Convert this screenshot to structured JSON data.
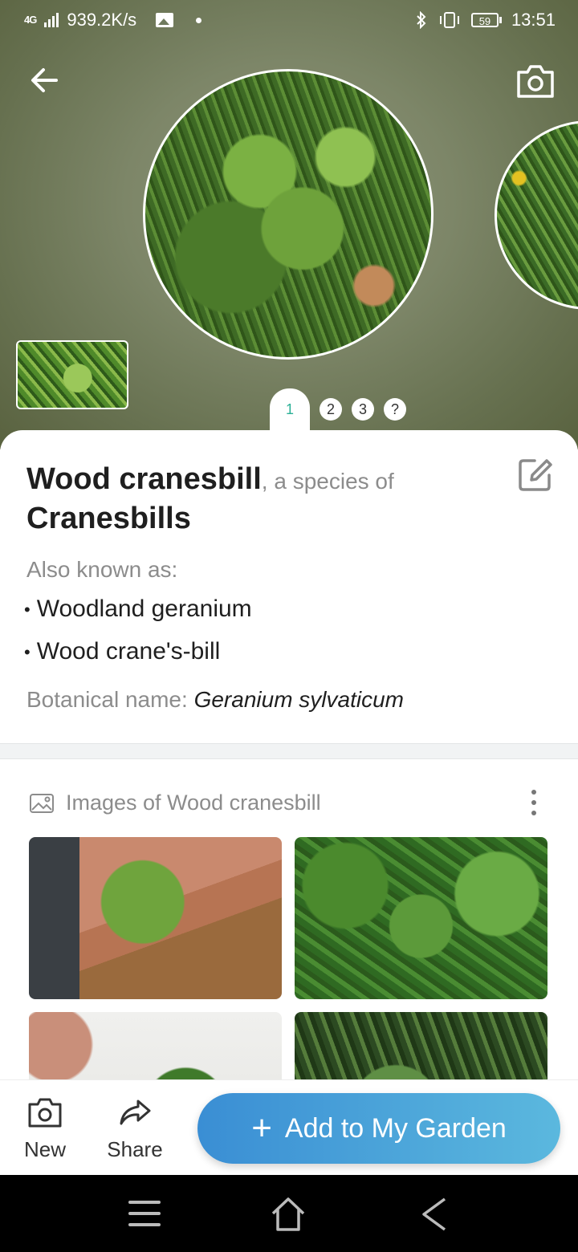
{
  "status_bar": {
    "network": "4G",
    "speed": "939.2K/s",
    "battery": "59",
    "time": "13:51"
  },
  "hero": {
    "pager": [
      "1",
      "2",
      "3",
      "?"
    ],
    "active_page": "1"
  },
  "plant": {
    "common_name": "Wood cranesbill",
    "separator": ", a species of",
    "genus": "Cranesbills",
    "aka_label": "Also known as:",
    "aliases": [
      "Woodland geranium",
      "Wood crane's-bill"
    ],
    "botanical_label": "Botanical name: ",
    "botanical_name": "Geranium sylvaticum"
  },
  "images": {
    "heading": "Images of Wood cranesbill"
  },
  "bottom_bar": {
    "new_label": "New",
    "share_label": "Share",
    "add_label": "Add to My Garden"
  },
  "colors": {
    "accent_teal": "#2ab096",
    "button_gradient_start": "#3a8ed4",
    "button_gradient_end": "#5bb8de"
  },
  "icons": {
    "back": "arrow-left-icon",
    "camera": "camera-icon",
    "edit": "edit-icon",
    "images": "image-icon",
    "more": "more-vertical-icon",
    "share": "share-icon",
    "nav_menu": "menu-icon",
    "nav_home": "home-icon",
    "nav_back": "back-icon"
  }
}
